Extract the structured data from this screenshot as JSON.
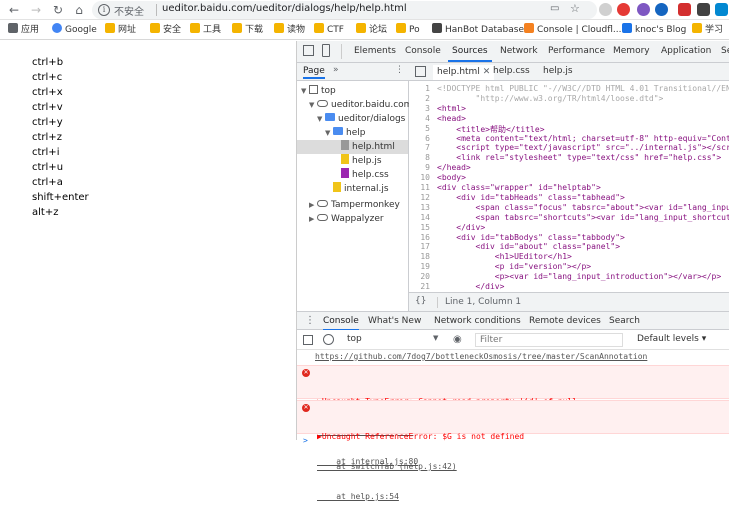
{
  "browser": {
    "security_label": "不安全",
    "url": "ueditor.baidu.com/ueditor/dialogs/help/help.html",
    "bookmarks": [
      {
        "label": "应用",
        "color": "#5f6368"
      },
      {
        "label": "Google",
        "color": "#4285f4"
      },
      {
        "label": "网址",
        "color": "#f4b400"
      },
      {
        "label": "安全",
        "color": "#f4b400"
      },
      {
        "label": "工具",
        "color": "#f4b400"
      },
      {
        "label": "下载",
        "color": "#f4b400"
      },
      {
        "label": "读物",
        "color": "#f4b400"
      },
      {
        "label": "CTF",
        "color": "#f4b400"
      },
      {
        "label": "论坛",
        "color": "#f4b400"
      },
      {
        "label": "Po",
        "color": "#f4b400"
      },
      {
        "label": "HanBot Database",
        "color": "#444444"
      },
      {
        "label": "Console | Cloudfl...",
        "color": "#f48120"
      },
      {
        "label": "knoc's Blog",
        "color": "#1a73e8"
      },
      {
        "label": "学习",
        "color": "#f4b400"
      }
    ]
  },
  "page": {
    "shortcuts": [
      "ctrl+b",
      "ctrl+c",
      "ctrl+x",
      "ctrl+v",
      "ctrl+y",
      "ctrl+z",
      "ctrl+i",
      "ctrl+u",
      "ctrl+a",
      "shift+enter",
      "alt+z"
    ]
  },
  "devtools": {
    "tabs": [
      "Elements",
      "Console",
      "Sources",
      "Network",
      "Performance",
      "Memory",
      "Application",
      "Se"
    ],
    "active_tab": "Sources",
    "navigator": {
      "header": "Page",
      "tree": [
        {
          "label": "top",
          "icon": "square",
          "depth": 0,
          "toggle": "▼"
        },
        {
          "label": "ueditor.baidu.com",
          "icon": "cloud",
          "depth": 1,
          "toggle": "▼"
        },
        {
          "label": "ueditor/dialogs",
          "icon": "folder",
          "depth": 2,
          "toggle": "▼"
        },
        {
          "label": "help",
          "icon": "folder",
          "depth": 3,
          "toggle": "▼"
        },
        {
          "label": "help.html",
          "icon": "file-html",
          "depth": 4,
          "toggle": "",
          "selected": true
        },
        {
          "label": "help.js",
          "icon": "file-js",
          "depth": 4,
          "toggle": ""
        },
        {
          "label": "help.css",
          "icon": "file-css",
          "depth": 4,
          "toggle": ""
        },
        {
          "label": "internal.js",
          "icon": "file-js",
          "depth": 3,
          "toggle": ""
        },
        {
          "label": "Tampermonkey",
          "icon": "cloud",
          "depth": 1,
          "toggle": "▶"
        },
        {
          "label": "Wappalyzer",
          "icon": "cloud",
          "depth": 1,
          "toggle": "▶"
        }
      ]
    },
    "editor": {
      "tabs": [
        "help.html",
        "help.css",
        "help.js"
      ],
      "active_tab": "help.html",
      "lines": [
        {
          "n": "1",
          "text": "<!DOCTYPE html PUBLIC \"-//W3C//DTD HTML 4.01 Transitional//EN\""
        },
        {
          "n": "2",
          "text": "        \"http://www.w3.org/TR/html4/loose.dtd\">"
        },
        {
          "n": "3",
          "text": "<html>"
        },
        {
          "n": "4",
          "text": "<head>"
        },
        {
          "n": "5",
          "text": "    <title>帮助</title>"
        },
        {
          "n": "6",
          "text": "    <meta content=\"text/html; charset=utf-8\" http-equiv=\"Conten"
        },
        {
          "n": "7",
          "text": "    <script type=\"text/javascript\" src=\"../internal.js\"></scri"
        },
        {
          "n": "8",
          "text": "    <link rel=\"stylesheet\" type=\"text/css\" href=\"help.css\">"
        },
        {
          "n": "9",
          "text": "</head>"
        },
        {
          "n": "10",
          "text": "<body>"
        },
        {
          "n": "11",
          "text": "<div class=\"wrapper\" id=\"helptab\">"
        },
        {
          "n": "12",
          "text": "    <div id=\"tabHeads\" class=\"tabhead\">"
        },
        {
          "n": "13",
          "text": "        <span class=\"focus\" tabsrc=\"about\"><var id=\"lang_input"
        },
        {
          "n": "14",
          "text": "        <span tabsrc=\"shortcuts\"><var id=\"lang_input_shortcuts"
        },
        {
          "n": "15",
          "text": "    </div>"
        },
        {
          "n": "16",
          "text": "    <div id=\"tabBodys\" class=\"tabbody\">"
        },
        {
          "n": "17",
          "text": "        <div id=\"about\" class=\"panel\">"
        },
        {
          "n": "18",
          "text": "            <h1>UEditor</h1>"
        },
        {
          "n": "19",
          "text": "            <p id=\"version\"></p>"
        },
        {
          "n": "20",
          "text": "            <p><var id=\"lang_input_introduction\"></var></p>"
        },
        {
          "n": "21",
          "text": "        </div>"
        }
      ],
      "status": "Line 1, Column 1"
    },
    "drawer_tabs": [
      "Console",
      "What's New",
      "Network conditions",
      "Remote devices",
      "Search"
    ],
    "drawer_active": "Console",
    "console": {
      "context": "top",
      "filter_placeholder": "Filter",
      "levels": "Default levels ▾",
      "messages": [
        {
          "type": "log",
          "text": "https://github.com/7dog7/bottleneckOsmosis/tree/master/ScanAnnotation"
        },
        {
          "type": "error",
          "lines": [
            "▶Uncaught TypeError: Cannot read property 'id' of null",
            "    at internal.js:4",
            "    at internal.js:80"
          ]
        },
        {
          "type": "error",
          "lines": [
            "▶Uncaught ReferenceError: $G is not defined",
            "    at switchTab (help.js:42)",
            "    at help.js:54"
          ]
        }
      ],
      "prompt": ">"
    }
  }
}
